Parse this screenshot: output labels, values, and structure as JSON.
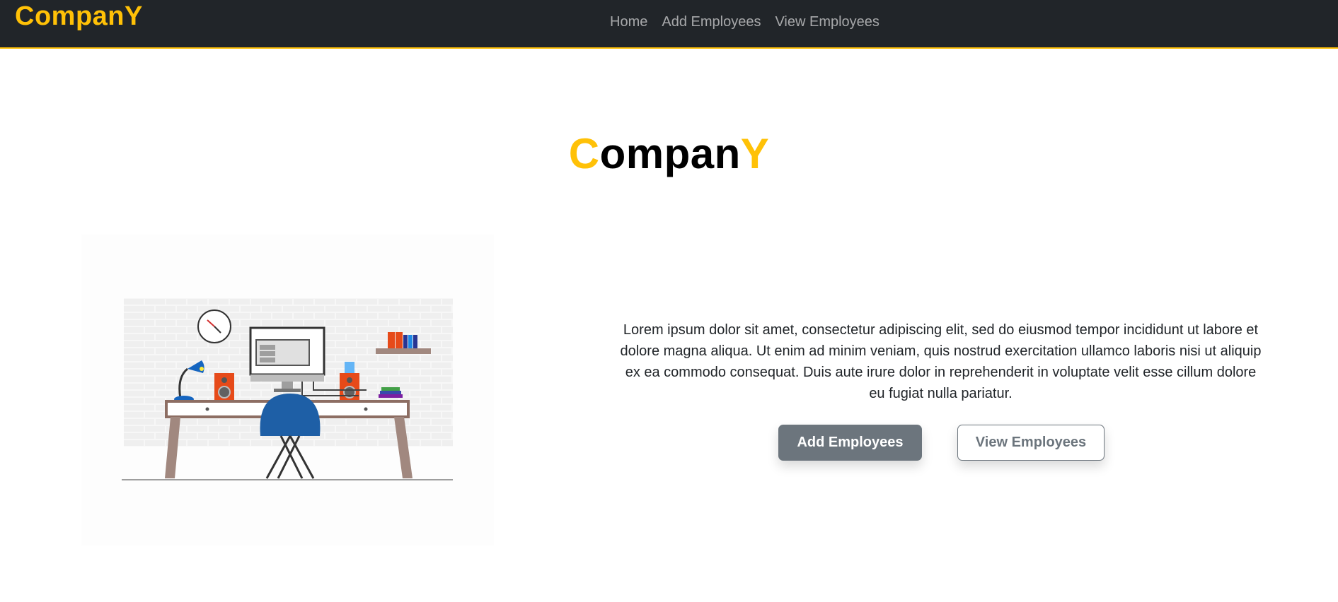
{
  "navbar": {
    "brand": "CompanY",
    "links": [
      {
        "label": "Home"
      },
      {
        "label": "Add Employees"
      },
      {
        "label": "View Employees"
      }
    ],
    "bg_color": "#212529",
    "accent_color": "#ffc107"
  },
  "hero": {
    "title_first": "C",
    "title_middle": "ompan",
    "title_last": "Y",
    "description": "Lorem ipsum dolor sit amet, consectetur adipiscing elit, sed do eiusmod tempor incididunt ut labore et dolore magna aliqua. Ut enim ad minim veniam, quis nostrud exercitation ullamco laboris nisi ut aliquip ex ea commodo consequat. Duis aute irure dolor in reprehenderit in voluptate velit esse cillum dolore eu fugiat nulla pariatur.",
    "primary_button": "Add Employees",
    "secondary_button": "View Employees",
    "illustration": "desk-workspace-illustration"
  }
}
